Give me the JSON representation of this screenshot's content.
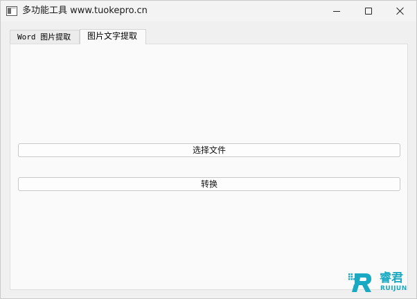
{
  "window": {
    "title": "多功能工具  www.tuokepro.cn"
  },
  "tabs": [
    {
      "label": "Word 图片提取",
      "active": false
    },
    {
      "label": "图片文字提取",
      "active": true
    }
  ],
  "main": {
    "select_file_label": "选择文件",
    "convert_label": "转换"
  },
  "logo": {
    "name_cn": "睿君",
    "name_en": "RUIJUN",
    "color": "#1aa9c2"
  },
  "icons": {
    "app": "app-window-icon",
    "minimize": "minimize-icon",
    "maximize": "maximize-icon",
    "close": "close-icon"
  }
}
